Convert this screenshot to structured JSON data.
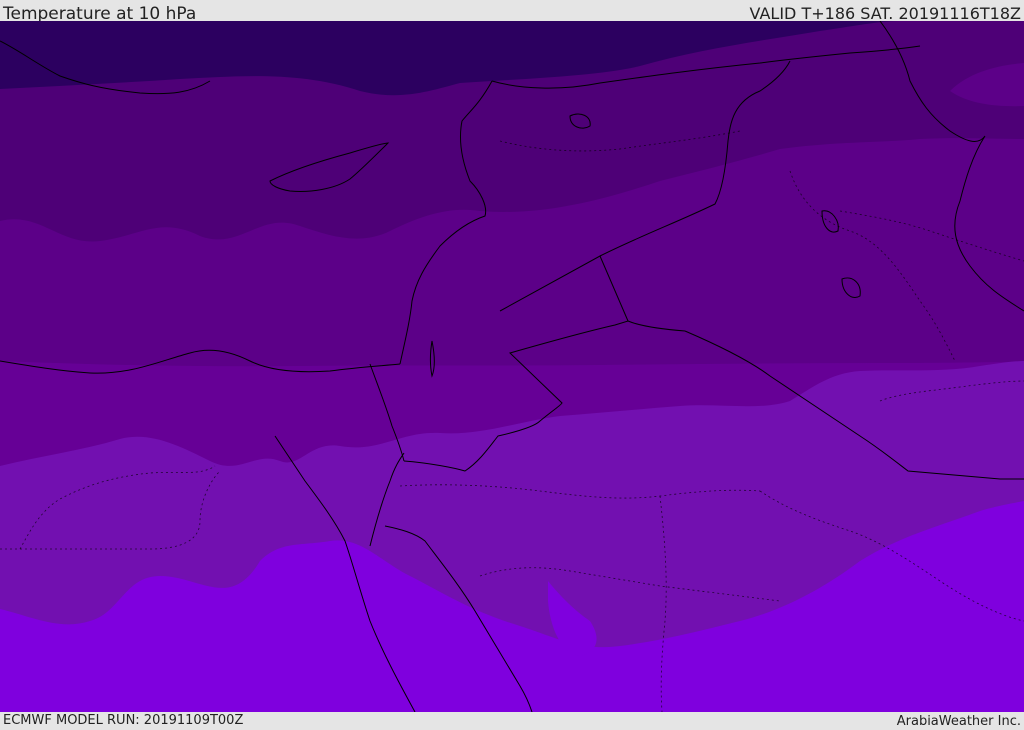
{
  "header": {
    "title": "Temperature at 10 hPa",
    "valid_time": "VALID T+186 SAT. 20191116T18Z"
  },
  "footer": {
    "model_run": "ECMWF MODEL RUN: 20191109T00Z",
    "credit": "ArabiaWeather Inc."
  },
  "map": {
    "colors": {
      "band_1": "#2c0060",
      "band_2": "#4e0077",
      "band_3": "#5c0088",
      "band_4": "#660096",
      "band_5": "#7210b0",
      "band_6": "#7f00de",
      "borders": "#000000"
    }
  }
}
